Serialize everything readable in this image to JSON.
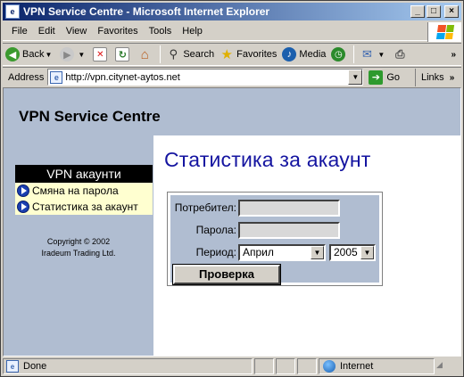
{
  "window": {
    "title": "VPN Service Centre - Microsoft Internet Explorer",
    "minimize": "_",
    "maximize": "□",
    "close": "×"
  },
  "menubar": {
    "items": [
      "File",
      "Edit",
      "View",
      "Favorites",
      "Tools",
      "Help"
    ]
  },
  "toolbar": {
    "back_label": "Back",
    "search_label": "Search",
    "favorites_label": "Favorites",
    "media_label": "Media"
  },
  "addressbar": {
    "label": "Address",
    "url": "http://vpn.citynet-aytos.net",
    "go_label": "Go",
    "links_label": "Links"
  },
  "page": {
    "site_title": "VPN Service Centre",
    "nav": {
      "title": "VPN акаунти",
      "items": [
        "Смяна на парола",
        "Статистика за акаунт"
      ]
    },
    "copyright_line1": "Copyright © 2002",
    "copyright_line2": "Iradeum Trading Ltd.",
    "heading": "Статистика за акаунт",
    "form": {
      "user_label": "Потребител:",
      "user_value": "",
      "password_label": "Парола:",
      "password_value": "",
      "period_label": "Период:",
      "month_selected": "Април",
      "year_selected": "2005",
      "submit_label": "Проверка"
    }
  },
  "statusbar": {
    "status": "Done",
    "zone": "Internet"
  }
}
